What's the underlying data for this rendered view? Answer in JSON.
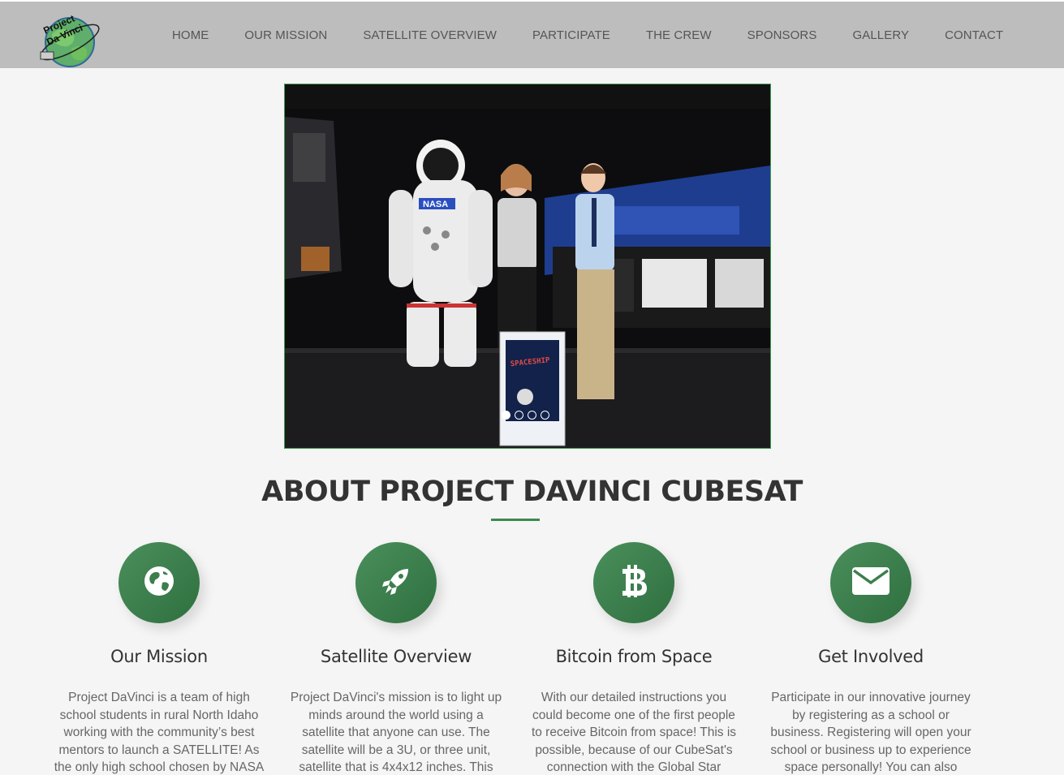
{
  "site": {
    "logo_line1": "Project",
    "logo_line2": "Da Vinci"
  },
  "nav": {
    "items": [
      {
        "label": "HOME"
      },
      {
        "label": "OUR MISSION"
      },
      {
        "label": "SATELLITE OVERVIEW"
      },
      {
        "label": "PARTICIPATE"
      },
      {
        "label": "THE CREW"
      },
      {
        "label": "SPONSORS"
      },
      {
        "label": "GALLERY"
      },
      {
        "label": "CONTACT"
      }
    ]
  },
  "carousel": {
    "slide_count": 4,
    "active_index": 0,
    "suit_badge": "NASA",
    "sign_text": "SPACESHIP"
  },
  "about": {
    "title": "ABOUT PROJECT DAVINCI CUBESAT",
    "accent_color": "#3c8a50",
    "features": [
      {
        "icon": "globe-icon",
        "title": "Our Mission",
        "text": "Project DaVinci is a team of high school students in rural North Idaho working with the community’s best mentors to launch a SATELLITE! As the only high school chosen by NASA"
      },
      {
        "icon": "rocket-icon",
        "title": "Satellite Overview",
        "text": "Project DaVinci's mission is to light up minds around the world using a satellite that anyone can use. The satellite will be a 3U, or three unit, satellite that is 4x4x12 inches. This"
      },
      {
        "icon": "bitcoin-icon",
        "title": "Bitcoin from Space",
        "text": "With our detailed instructions you could become one of the first people to receive Bitcoin from space! This is possible, because of our CubeSat's connection with the Global Star"
      },
      {
        "icon": "envelope-icon",
        "title": "Get Involved",
        "text": "Participate in our innovative journey by registering as a school or business. Registering will open your school or business up to experience space personally! You can also"
      }
    ]
  }
}
